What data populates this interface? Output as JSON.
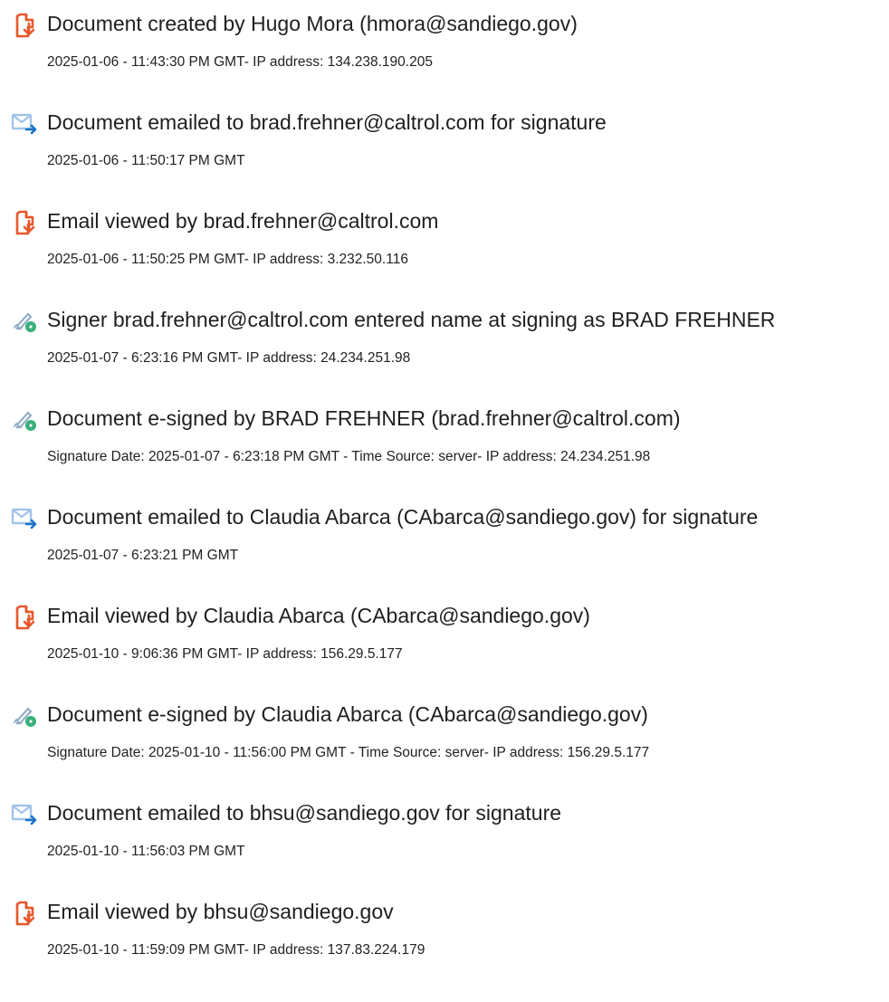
{
  "colors": {
    "created_icon": "#e8582b",
    "email_icon_envelope": "#9fc4ea",
    "email_icon_arrow": "#1a73c8",
    "sign_icon_pen": "#8aa9c4",
    "sign_icon_badge": "#3ab07a"
  },
  "entries": [
    {
      "icon": "document-created-icon",
      "title": "Document created by Hugo Mora (hmora@sandiego.gov)",
      "detail": "2025-01-06 - 11:43:30 PM GMT- IP address: 134.238.190.205"
    },
    {
      "icon": "email-sent-icon",
      "title": "Document emailed to brad.frehner@caltrol.com for signature",
      "detail": "2025-01-06 - 11:50:17 PM GMT"
    },
    {
      "icon": "document-viewed-icon",
      "title": "Email viewed by brad.frehner@caltrol.com",
      "detail": "2025-01-06 - 11:50:25 PM GMT- IP address: 3.232.50.116"
    },
    {
      "icon": "e-sign-icon",
      "title": "Signer brad.frehner@caltrol.com entered name at signing as BRAD FREHNER",
      "detail": "2025-01-07 - 6:23:16 PM GMT- IP address: 24.234.251.98"
    },
    {
      "icon": "e-sign-icon",
      "title": "Document e-signed by BRAD FREHNER (brad.frehner@caltrol.com)",
      "detail": "Signature Date: 2025-01-07 - 6:23:18 PM GMT - Time Source: server- IP address: 24.234.251.98"
    },
    {
      "icon": "email-sent-icon",
      "title": "Document emailed to Claudia Abarca (CAbarca@sandiego.gov) for signature",
      "detail": "2025-01-07 - 6:23:21 PM GMT"
    },
    {
      "icon": "document-viewed-icon",
      "title": "Email viewed by Claudia Abarca (CAbarca@sandiego.gov)",
      "detail": "2025-01-10 - 9:06:36 PM GMT- IP address: 156.29.5.177"
    },
    {
      "icon": "e-sign-icon",
      "title": "Document e-signed by Claudia Abarca (CAbarca@sandiego.gov)",
      "detail": "Signature Date: 2025-01-10 - 11:56:00 PM GMT - Time Source: server- IP address: 156.29.5.177"
    },
    {
      "icon": "email-sent-icon",
      "title": "Document emailed to bhsu@sandiego.gov for signature",
      "detail": "2025-01-10 - 11:56:03 PM GMT"
    },
    {
      "icon": "document-viewed-icon",
      "title": "Email viewed by bhsu@sandiego.gov",
      "detail": "2025-01-10 - 11:59:09 PM GMT- IP address: 137.83.224.179"
    }
  ]
}
